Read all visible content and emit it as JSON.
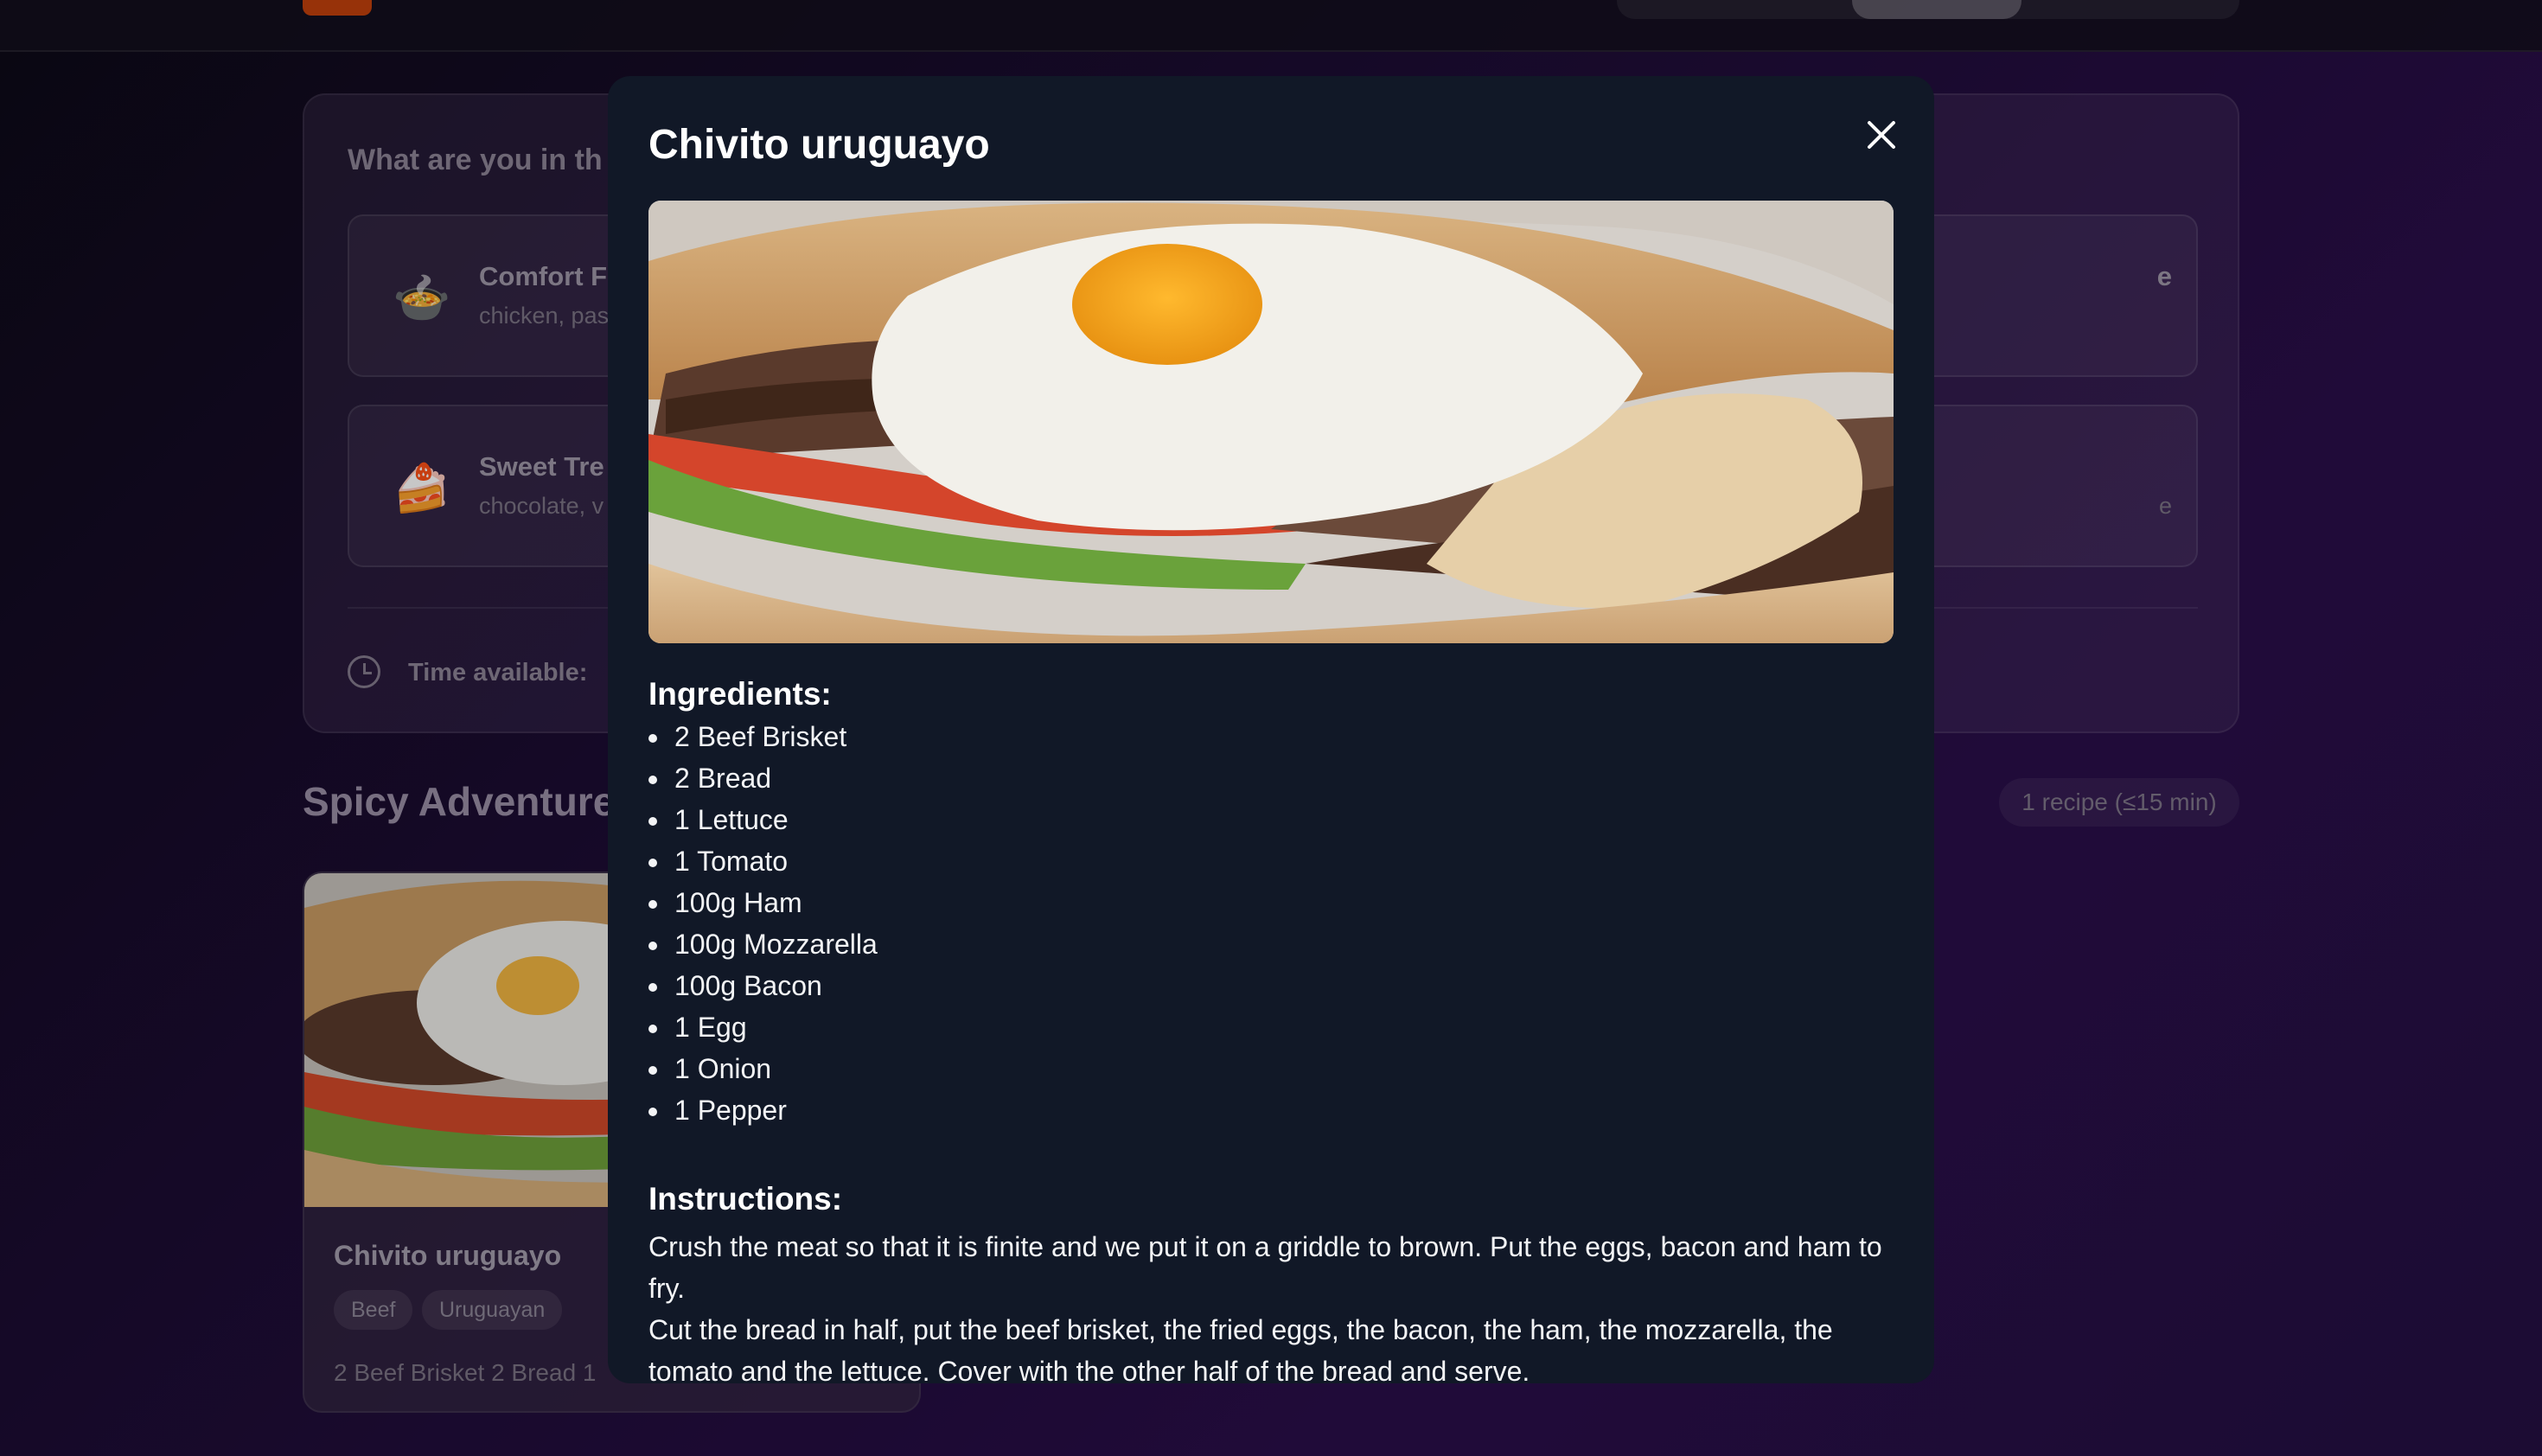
{
  "colors": {
    "modal_bg": "#111827",
    "accent": "#c2410c",
    "page_bg": "#1c0c33"
  },
  "background": {
    "preferences": {
      "question": "What are you in th",
      "moods": [
        {
          "emoji": "🍲",
          "title": "Comfort F",
          "sub": "chicken, pas"
        },
        {
          "emoji": "🍰",
          "title": "Sweet Tre",
          "sub": "chocolate, v"
        }
      ],
      "right_card_fragments": [
        "e",
        "e"
      ],
      "time_label": "Time available:"
    },
    "section": {
      "title": "Spicy Adventure",
      "count": "1 recipe (≤15 min)"
    },
    "recipe_card": {
      "name": "Chivito uruguayo",
      "tags": [
        "Beef",
        "Uruguayan"
      ],
      "preview": "2 Beef Brisket   2 Bread   1"
    }
  },
  "modal": {
    "title": "Chivito uruguayo",
    "close_icon": "close-icon",
    "ingredients_heading": "Ingredients:",
    "ingredients": [
      "2 Beef Brisket",
      "2 Bread",
      "1 Lettuce",
      "1 Tomato",
      "100g Ham",
      "100g Mozzarella",
      "100g Bacon",
      "1 Egg",
      "1 Onion",
      "1 Pepper"
    ],
    "instructions_heading": "Instructions:",
    "instructions": [
      "Crush the meat so that it is finite and we put it on a griddle to brown. Put the eggs, bacon and ham to fry.",
      "Cut the bread in half, put the beef brisket, the fried eggs, the bacon, the ham, the mozzarella, the tomato and the lettuce. Cover with the other half of the bread and serve."
    ]
  }
}
